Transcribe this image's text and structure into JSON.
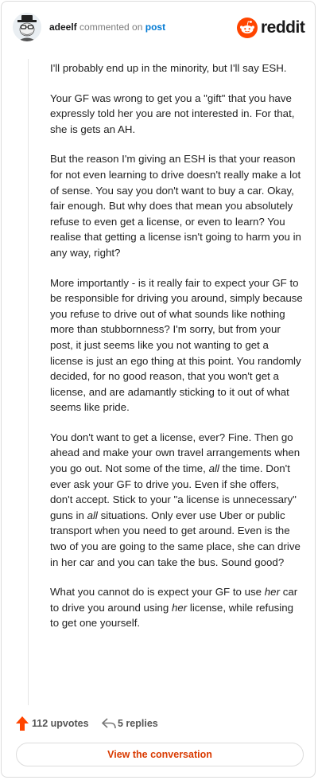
{
  "header": {
    "username": "adeelf",
    "action_text": "commented on",
    "post_link": "post",
    "brand": "reddit"
  },
  "comment": {
    "p1": "I'll probably end up in the minority, but I'll say ESH.",
    "p2": "Your GF was wrong to get you a \"gift\" that you have expressly told her you are not interested in. For that, she is gets an AH.",
    "p3": "But the reason I'm giving an ESH is that your reason for not even learning to drive doesn't really make a lot of sense. You say you don't want to buy a car. Okay, fair enough. But why does that mean you absolutely refuse to even get a license, or even to learn? You realise that getting a license isn't going to harm you in any way, right?",
    "p4": "More importantly - is it really fair to expect your GF to be responsible for driving you around, simply because you refuse to drive out of what sounds like nothing more than stubbornness? I'm sorry, but from your post, it just seems like you not wanting to get a license is just an ego thing at this point. You randomly decided, for no good reason, that you won't get a license, and are adamantly sticking to it out of what seems like pride.",
    "p5": {
      "a": "You don't want to get a license, ever? Fine. Then go ahead and make your own travel arrangements when you go out. Not some of the time, ",
      "all1": "all",
      "b": " the time. Don't ever ask your GF to drive you. Even if she offers, don't accept. Stick to your \"a license is unnecessary\" guns in ",
      "all2": "all",
      "c": " situations. Only ever use Uber or public transport when you need to get around. Even is the two of you are going to the same place, she can drive in her car and you can take the bus. Sound good?"
    },
    "p6": {
      "a": "What you cannot do is expect your GF to use ",
      "her1": "her",
      "b": " car to drive you around using ",
      "her2": "her",
      "c": " license, while refusing to get one yourself."
    }
  },
  "footer": {
    "upvotes": "112 upvotes",
    "replies": "5 replies",
    "cta": "View the conversation"
  },
  "colors": {
    "accent": "#ff4500",
    "link": "#0079d3",
    "cta_text": "#d93a00"
  }
}
